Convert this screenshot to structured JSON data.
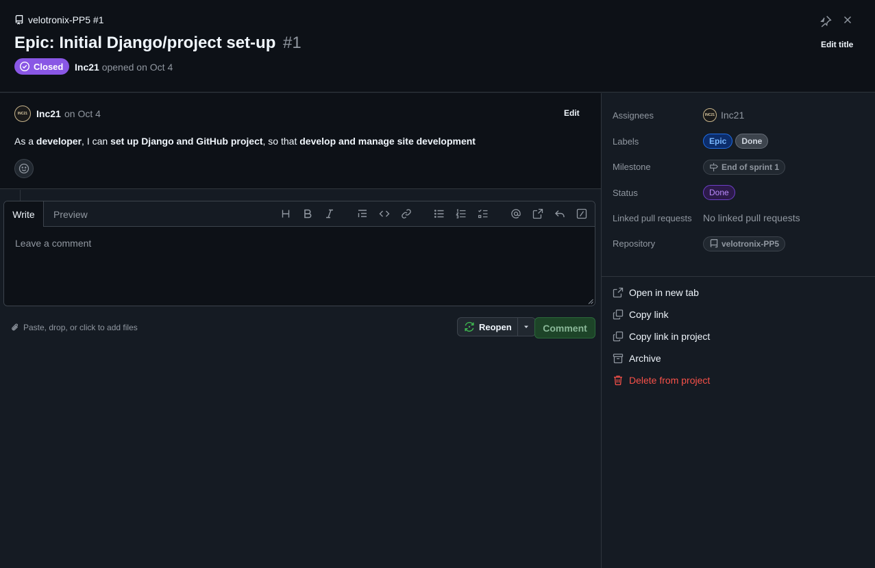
{
  "header": {
    "repo_ref": "velotronix-PP5 #1",
    "title": "Epic: Initial Django/project set-up",
    "number": "#1",
    "state": "Closed",
    "author": "Inc21",
    "opened_text": "opened on Oct 4",
    "edit_title_label": "Edit title",
    "pin_icon": "pin-icon",
    "close_icon": "x-icon"
  },
  "comment": {
    "author": "Inc21",
    "date": "on Oct 4",
    "edit_label": "Edit",
    "avatar_text": "INC21",
    "body": [
      {
        "text": "As a ",
        "bold": false
      },
      {
        "text": "developer",
        "bold": true
      },
      {
        "text": ", I can ",
        "bold": false
      },
      {
        "text": "set up Django and GitHub project",
        "bold": true
      },
      {
        "text": ", so that ",
        "bold": false
      },
      {
        "text": "develop and manage site development",
        "bold": true
      }
    ]
  },
  "editor": {
    "tabs": {
      "write": "Write",
      "preview": "Preview"
    },
    "placeholder": "Leave a comment",
    "toolbar": [
      "heading-icon",
      "bold-icon",
      "italic-icon",
      "quote-icon",
      "code-icon",
      "link-icon",
      "unordered-list-icon",
      "ordered-list-icon",
      "tasklist-icon",
      "mention-icon",
      "cross-reference-icon",
      "reply-icon",
      "slash-commands-icon"
    ],
    "attach_label": "Paste, drop, or click to add files",
    "reopen_label": "Reopen",
    "comment_label": "Comment"
  },
  "sidebar": {
    "assignees_label": "Assignees",
    "assignee": "Inc21",
    "labels_label": "Labels",
    "labels": [
      "Epic",
      "Done"
    ],
    "milestone_label": "Milestone",
    "milestone": "End of sprint 1",
    "status_label": "Status",
    "status": "Done",
    "linked_pr_label": "Linked pull requests",
    "linked_pr_value": "No linked pull requests",
    "repository_label": "Repository",
    "repository": "velotronix-PP5",
    "actions": {
      "open_new_tab": "Open in new tab",
      "copy_link": "Copy link",
      "copy_link_project": "Copy link in project",
      "archive": "Archive",
      "delete": "Delete from project"
    }
  },
  "colors": {
    "closed_badge": "#8957e5",
    "danger": "#f85149",
    "comment_button": "#1d4428"
  }
}
